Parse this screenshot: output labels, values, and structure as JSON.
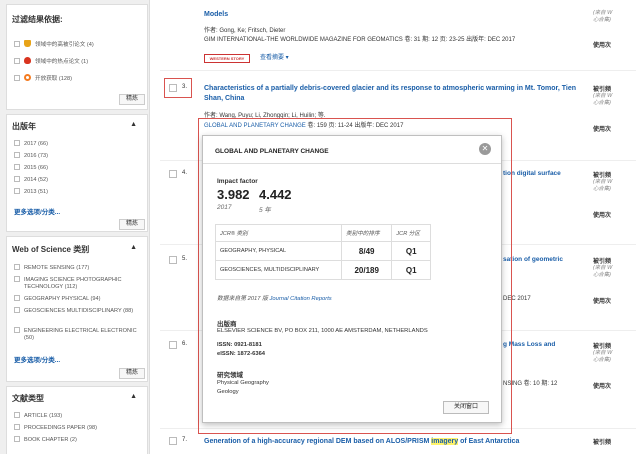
{
  "sidebar": {
    "refine_panel": {
      "title": "过滤结果依据:",
      "items": [
        {
          "label": "领域中的高被引论文 (4)",
          "icon": "trophy-icon",
          "color": "#e8a317"
        },
        {
          "label": "领域中的热点论文 (1)",
          "icon": "flame-icon",
          "color": "#d9341f"
        },
        {
          "label": "开放获取 (128)",
          "icon": "open-access-icon",
          "color": "#f47b20"
        }
      ],
      "refine_label": "精炼"
    },
    "year_panel": {
      "title": "出版年",
      "items": [
        "2017 (66)",
        "2016 (73)",
        "2015 (66)",
        "2014 (52)",
        "2013 (51)"
      ],
      "more_label": "更多选项/分类...",
      "refine_label": "精炼"
    },
    "wos_panel": {
      "title": "Web of Science 类别",
      "items": [
        "REMOTE SENSING (177)",
        "IMAGING SCIENCE PHOTOGRAPHIC TECHNOLOGY (112)",
        "GEOGRAPHY PHYSICAL (94)",
        "GEOSCIENCES MULTIDISCIPLINARY (88)",
        "ENGINEERING ELECTRICAL ELECTRONIC (50)"
      ],
      "more_label": "更多选项/分类...",
      "refine_label": "精炼"
    },
    "doctype_panel": {
      "title": "文献类型",
      "items": [
        "ARTICLE (193)",
        "PROCEEDINGS PAPER (98)",
        "BOOK CHAPTER (2)"
      ]
    }
  },
  "results": {
    "r0": {
      "title_tail": "Models",
      "authors": "作者: Gong, Ke; Fritsch, Dieter",
      "source": "GIM INTERNATIONAL-THE WORLDWIDE MAGAZINE FOR GEOMATICS  卷: 31  期: 12  页: 23-25  出版年: DEC 2017",
      "badge": "WESTERN STORY",
      "view_abstract": "查看摘要 ▾",
      "side": "使用次"
    },
    "r3": {
      "number": "3.",
      "title": "Characteristics of a partially debris-covered glacier and its response to atmospheric warming in Mt. Tomor, Tien Shan, China",
      "authors": "作者: Wang, Puyu; Li, Zhongqin; Li, Huilin; 等.",
      "journal": "GLOBAL AND PLANETARY CHANGE",
      "source_rest": " 卷: 159  页: 11-24  出版年: DEC 2017",
      "side1": "被引频",
      "side2": "(来自 W",
      "side3": "心合集)",
      "side4": "使用次"
    },
    "r4": {
      "number": "4.",
      "frag": "tion digital surface",
      "side1": "被引频",
      "side2": "(来自 W",
      "side3": "心合集)",
      "side4": "使用次"
    },
    "r5": {
      "number": "5.",
      "frag": "sation of geometric",
      "frag2": "DEC 2017",
      "side1": "被引频",
      "side2": "(来自 W",
      "side3": "心合集)",
      "side4": "使用次"
    },
    "r6": {
      "number": "6.",
      "frag": "g Mass Loss and",
      "frag2": "NSING  卷: 10  期: 12",
      "side1": "被引频",
      "side2": "(来自 W",
      "side3": "心合集)",
      "side4": "使用次"
    },
    "r7": {
      "number": "7.",
      "title_pre": "Generation of a high-accuracy regional DEM based on ALOS/PRISM ",
      "title_hl": "imagery",
      "title_post": " of East Antarctica",
      "side1": "被引频"
    },
    "r2_side": {
      "side1": "(来自 W",
      "side2": "心合集)"
    }
  },
  "popup": {
    "title": "GLOBAL AND PLANETARY CHANGE",
    "impact_label": "Impact factor",
    "if_value": "3.982",
    "if_year": "2017",
    "if5_value": "4.442",
    "if5_label": "5 年",
    "table": {
      "headers": [
        "JCR® 类别",
        "类别中的排序",
        "JCR 分区"
      ],
      "rows": [
        {
          "category": "GEOGRAPHY, PHYSICAL",
          "rank": "8/49",
          "quartile": "Q1"
        },
        {
          "category": "GEOSCIENCES, MULTIDISCIPLINARY",
          "rank": "20/189",
          "quartile": "Q1"
        }
      ]
    },
    "source_pre": "数据来自第 2017 版 ",
    "source_link": "Journal Citation Reports",
    "publisher_label": "出版商",
    "publisher": "ELSEVIER SCIENCE BV, PO BOX 211, 1000 AE AMSTERDAM, NETHERLANDS",
    "issn": "ISSN: 0921-8181",
    "eissn": "eISSN: 1872-6364",
    "research_label": "研究领域",
    "research_areas": [
      "Physical Geography",
      "Geology"
    ],
    "close_label": "关闭窗口"
  }
}
